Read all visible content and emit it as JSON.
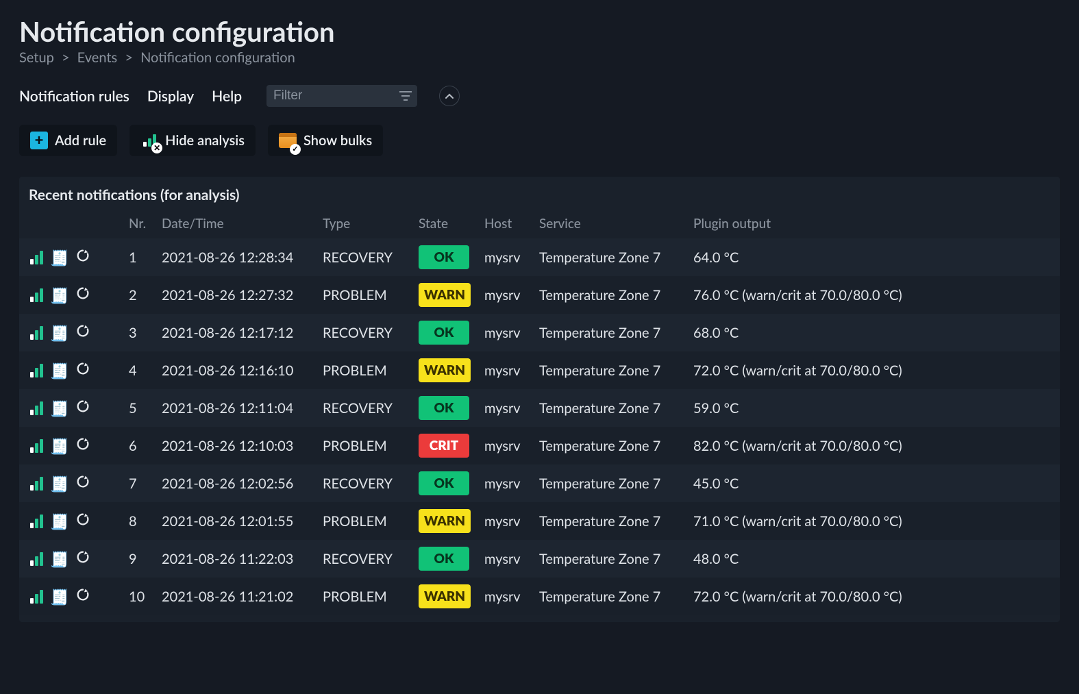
{
  "header": {
    "title": "Notification configuration",
    "breadcrumb": [
      "Setup",
      "Events",
      "Notification configuration"
    ]
  },
  "menubar": {
    "items": [
      "Notification rules",
      "Display",
      "Help"
    ],
    "filter_placeholder": "Filter"
  },
  "actions": {
    "add_rule": "Add rule",
    "hide_analysis": "Hide analysis",
    "show_bulks": "Show bulks"
  },
  "panel": {
    "title": "Recent notifications (for analysis)"
  },
  "columns": {
    "nr": "Nr.",
    "datetime": "Date/Time",
    "type": "Type",
    "state": "State",
    "host": "Host",
    "service": "Service",
    "plugin": "Plugin output"
  },
  "rows": [
    {
      "nr": "1",
      "datetime": "2021-08-26 12:28:34",
      "type": "RECOVERY",
      "state": "OK",
      "host": "mysrv",
      "service": "Temperature Zone 7",
      "plugin": "64.0 °C"
    },
    {
      "nr": "2",
      "datetime": "2021-08-26 12:27:32",
      "type": "PROBLEM",
      "state": "WARN",
      "host": "mysrv",
      "service": "Temperature Zone 7",
      "plugin": "76.0 °C (warn/crit at 70.0/80.0 °C)"
    },
    {
      "nr": "3",
      "datetime": "2021-08-26 12:17:12",
      "type": "RECOVERY",
      "state": "OK",
      "host": "mysrv",
      "service": "Temperature Zone 7",
      "plugin": "68.0 °C"
    },
    {
      "nr": "4",
      "datetime": "2021-08-26 12:16:10",
      "type": "PROBLEM",
      "state": "WARN",
      "host": "mysrv",
      "service": "Temperature Zone 7",
      "plugin": "72.0 °C (warn/crit at 70.0/80.0 °C)"
    },
    {
      "nr": "5",
      "datetime": "2021-08-26 12:11:04",
      "type": "RECOVERY",
      "state": "OK",
      "host": "mysrv",
      "service": "Temperature Zone 7",
      "plugin": "59.0 °C"
    },
    {
      "nr": "6",
      "datetime": "2021-08-26 12:10:03",
      "type": "PROBLEM",
      "state": "CRIT",
      "host": "mysrv",
      "service": "Temperature Zone 7",
      "plugin": "82.0 °C (warn/crit at 70.0/80.0 °C)"
    },
    {
      "nr": "7",
      "datetime": "2021-08-26 12:02:56",
      "type": "RECOVERY",
      "state": "OK",
      "host": "mysrv",
      "service": "Temperature Zone 7",
      "plugin": "45.0 °C"
    },
    {
      "nr": "8",
      "datetime": "2021-08-26 12:01:55",
      "type": "PROBLEM",
      "state": "WARN",
      "host": "mysrv",
      "service": "Temperature Zone 7",
      "plugin": "71.0 °C (warn/crit at 70.0/80.0 °C)"
    },
    {
      "nr": "9",
      "datetime": "2021-08-26 11:22:03",
      "type": "RECOVERY",
      "state": "OK",
      "host": "mysrv",
      "service": "Temperature Zone 7",
      "plugin": "48.0 °C"
    },
    {
      "nr": "10",
      "datetime": "2021-08-26 11:21:02",
      "type": "PROBLEM",
      "state": "WARN",
      "host": "mysrv",
      "service": "Temperature Zone 7",
      "plugin": "72.0 °C (warn/crit at 70.0/80.0 °C)"
    }
  ]
}
